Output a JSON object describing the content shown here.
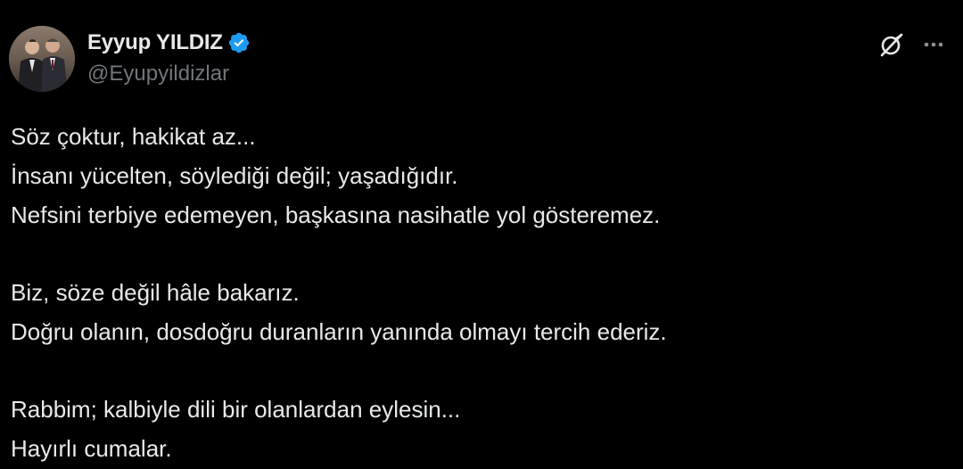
{
  "author": {
    "display_name": "Eyyup YILDIZ",
    "handle": "@Eyupyildizlar",
    "verified": true,
    "verified_color": "#1d9bf0",
    "avatar_icon": "profile-photo"
  },
  "actions": {
    "grok_icon": "grok-icon",
    "more_icon": "more-horizontal-icon"
  },
  "tweet": {
    "paragraphs": [
      {
        "lines": [
          "Söz çoktur, hakikat az...",
          "İnsanı yücelten, söylediği değil; yaşadığıdır.",
          "Nefsini terbiye edemeyen, başkasına nasihatle yol gösteremez."
        ]
      },
      {
        "lines": [
          "Biz, söze değil hâle bakarız.",
          "Doğru olanın, dosdoğru duranların yanında olmayı tercih ederiz."
        ]
      },
      {
        "lines": [
          "Rabbim; kalbiyle dili bir olanlardan eylesin...",
          "Hayırlı cumalar."
        ]
      }
    ]
  },
  "colors": {
    "background": "#000000",
    "text_primary": "#e7e9ea",
    "text_secondary": "#71767b"
  }
}
